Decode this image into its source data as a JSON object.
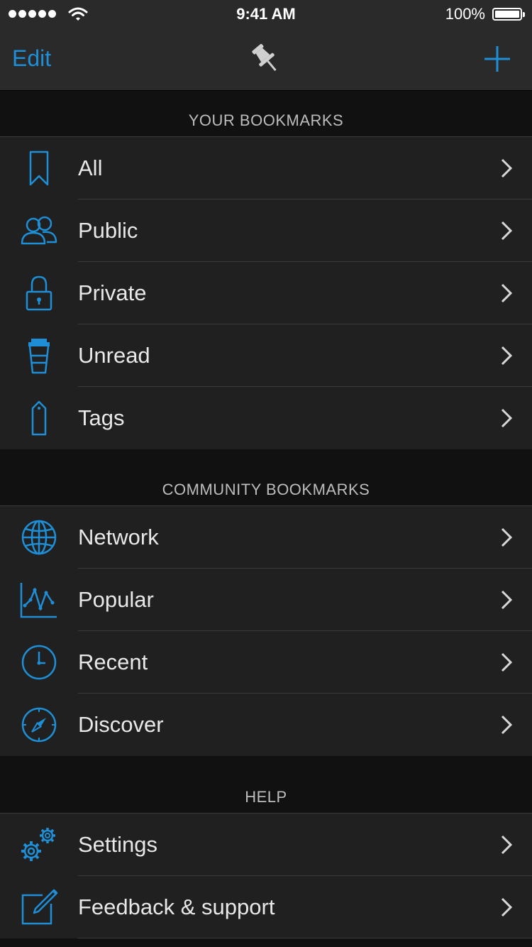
{
  "status_bar": {
    "time": "9:41 AM",
    "battery": "100%"
  },
  "nav": {
    "edit_label": "Edit",
    "center_icon": "pushpin-icon",
    "add_icon": "plus-icon"
  },
  "colors": {
    "accent": "#1e8fd6",
    "background": "#111111",
    "row_background": "#202020",
    "text": "#e8e8e8",
    "header_text": "#bdbdbd"
  },
  "sections": {
    "your_bookmarks": {
      "title": "YOUR BOOKMARKS",
      "items": [
        {
          "label": "All",
          "icon": "bookmark-icon"
        },
        {
          "label": "Public",
          "icon": "users-icon"
        },
        {
          "label": "Private",
          "icon": "lock-icon"
        },
        {
          "label": "Unread",
          "icon": "cup-icon"
        },
        {
          "label": "Tags",
          "icon": "tag-icon"
        }
      ]
    },
    "community_bookmarks": {
      "title": "COMMUNITY BOOKMARKS",
      "items": [
        {
          "label": "Network",
          "icon": "globe-icon"
        },
        {
          "label": "Popular",
          "icon": "line-chart-icon"
        },
        {
          "label": "Recent",
          "icon": "clock-icon"
        },
        {
          "label": "Discover",
          "icon": "compass-icon"
        }
      ]
    },
    "help": {
      "title": "HELP",
      "items": [
        {
          "label": "Settings",
          "icon": "gears-icon"
        },
        {
          "label": "Feedback & support",
          "icon": "edit-icon"
        }
      ]
    }
  }
}
